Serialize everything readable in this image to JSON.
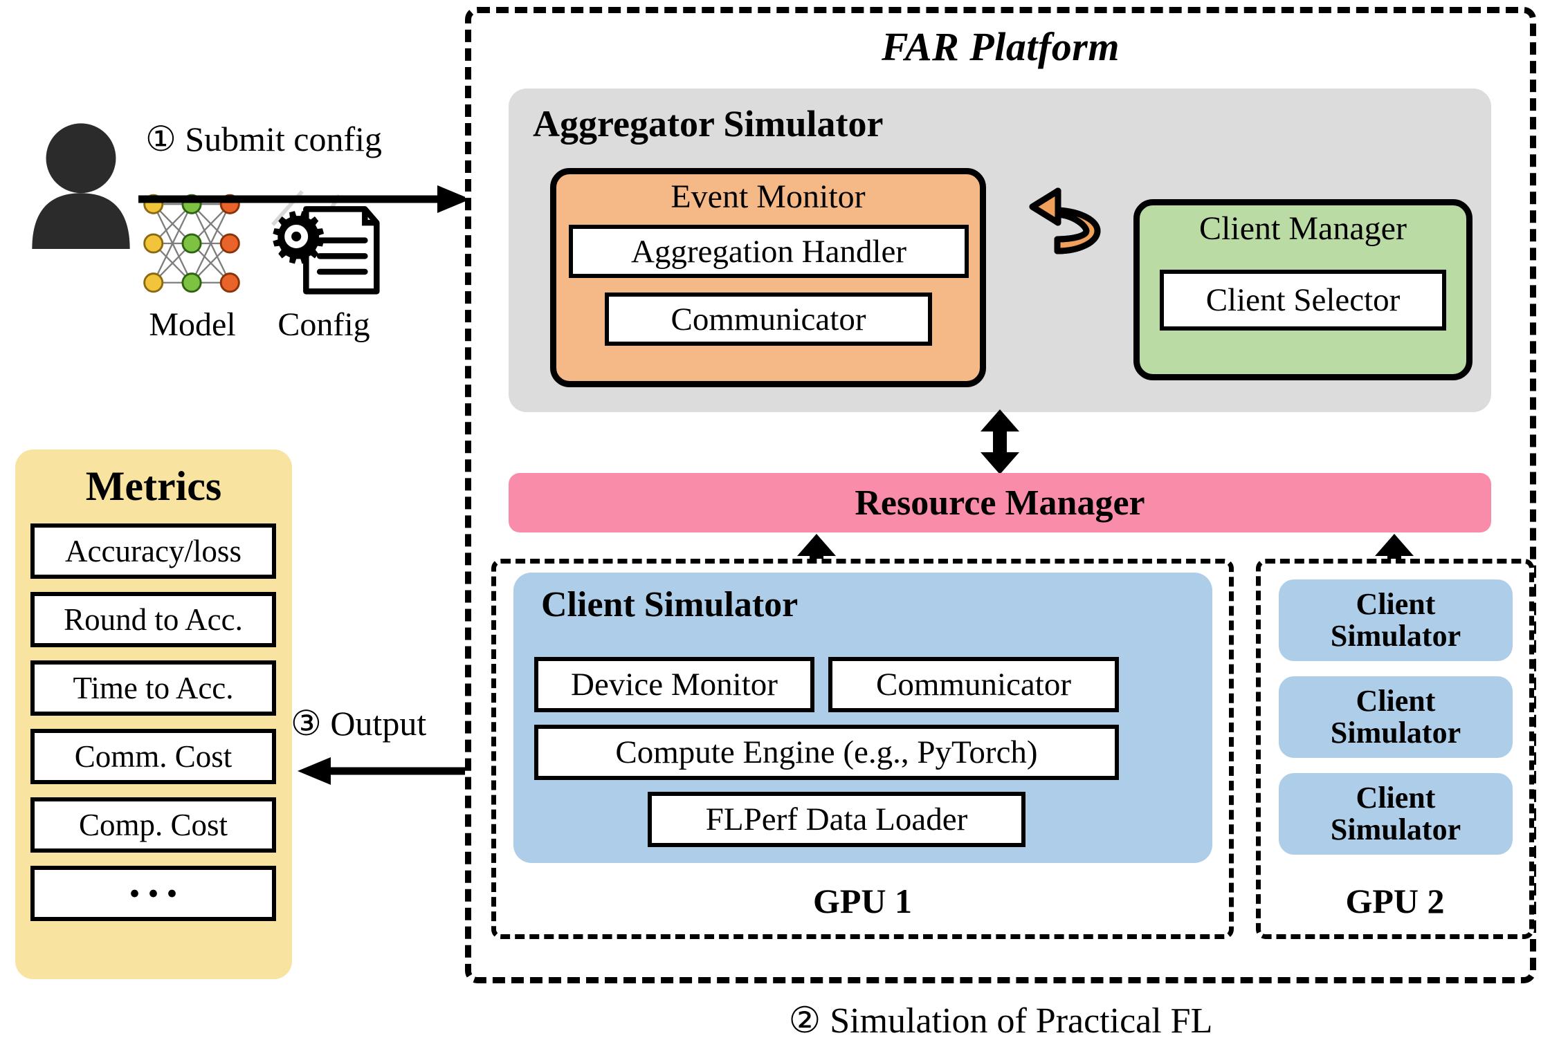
{
  "platform": {
    "title": "FAR Platform",
    "aggregator": {
      "title": "Aggregator Simulator",
      "event_monitor": {
        "title": "Event Monitor",
        "items": [
          "Aggregation Handler",
          "Communicator"
        ]
      },
      "sync_icon": "circular-sync-arrows-icon",
      "client_manager": {
        "title": "Client Manager",
        "items": [
          "Client Selector"
        ]
      }
    },
    "resource_manager": "Resource Manager",
    "gpu1": {
      "label": "GPU 1",
      "client_simulator": {
        "title": "Client Simulator",
        "row1": [
          "Device Monitor",
          "Communicator"
        ],
        "row2": [
          "Compute Engine (e.g., PyTorch)"
        ],
        "row3": [
          "FLPerf Data Loader"
        ]
      }
    },
    "gpu2": {
      "label": "GPU 2",
      "client_simulators": [
        "Client Simulator",
        "Client Simulator",
        "Client Simulator"
      ]
    }
  },
  "metrics": {
    "title": "Metrics",
    "items": [
      "Accuracy/loss",
      "Round to Acc.",
      "Time to Acc.",
      "Comm. Cost",
      "Comp. Cost",
      "• • •"
    ]
  },
  "actors": {
    "user_icon": "user-avatar-icon",
    "model_label": "Model",
    "config_label": "Config",
    "model_icon": "neural-network-icon",
    "config_icon": "gear-document-icon"
  },
  "steps": {
    "step1": "① Submit config",
    "step2": "② Simulation of Practical FL",
    "step3": "③ Output"
  },
  "colors": {
    "aggregator_bg": "#DCDCDC",
    "event_monitor_bg": "#F5B887",
    "client_manager_bg": "#BADBA4",
    "resource_manager_bg": "#F98CA8",
    "client_simulator_bg": "#AECDE8",
    "metrics_bg": "#F8E3A1",
    "nn_input": "#F2C43C",
    "nn_hidden": "#7DC242",
    "nn_output": "#E8642A"
  }
}
